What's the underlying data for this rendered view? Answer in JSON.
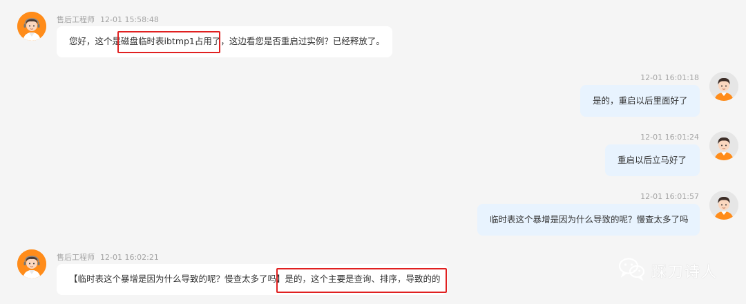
{
  "messages": [
    {
      "sender": "售后工程师",
      "time": "12-01 15:58:48",
      "pre": "您好，这个是",
      "highlight": "磁盘临时表ibtmp1占用了",
      "post": "，这边看您是否重启过实例？已经释放了。"
    },
    {
      "time": "12-01 16:01:18",
      "text": "是的，重启以后里面好了"
    },
    {
      "time": "12-01 16:01:24",
      "text": "重启以后立马好了"
    },
    {
      "time": "12-01 16:01:57",
      "text": "临时表这个暴增是因为什么导致的呢？慢查太多了吗"
    },
    {
      "sender": "售后工程师",
      "time": "12-01 16:02:21",
      "pre": "【临时表这个暴增是因为什么导致的呢？慢查太多了吗】",
      "highlight": "是的，这个主要是查询、排序，导致的的"
    }
  ],
  "watermark": {
    "text": "踩刀诗人",
    "icon": "wechat-icon"
  },
  "colors": {
    "page_bg": "#f5f5f5",
    "left_bubble": "#ffffff",
    "right_bubble": "#e8f3fe",
    "highlight_box": "#e02020",
    "agent_avatar_bg": "#ff8c1a"
  }
}
